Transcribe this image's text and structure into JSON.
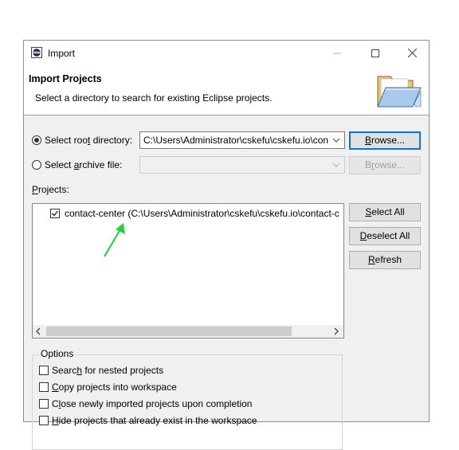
{
  "window": {
    "title": "Import"
  },
  "header": {
    "title": "Import Projects",
    "description": "Select a directory to search for existing Eclipse projects."
  },
  "source": {
    "root_label": "Select root directory:",
    "root_path": "C:\\Users\\Administrator\\cskefu\\cskefu.io\\con",
    "archive_label": "Select archive file:",
    "archive_path": "",
    "browse_root": "Browse...",
    "browse_archive": "Browse..."
  },
  "projects": {
    "label": "Projects:",
    "items": [
      {
        "label": "contact-center (C:\\Users\\Administrator\\cskefu\\cskefu.io\\contact-c",
        "checked": true
      }
    ],
    "select_all": "Select All",
    "deselect_all": "Deselect All",
    "refresh": "Refresh"
  },
  "options": {
    "title": "Options",
    "items": [
      {
        "label": "Search for nested projects",
        "checked": false
      },
      {
        "label": "Copy projects into workspace",
        "checked": false
      },
      {
        "label": "Close newly imported projects upon completion",
        "checked": false
      },
      {
        "label": "Hide projects that already exist in the workspace",
        "checked": false
      }
    ]
  },
  "annotation": {
    "arrow_color": "#2ecc40"
  }
}
